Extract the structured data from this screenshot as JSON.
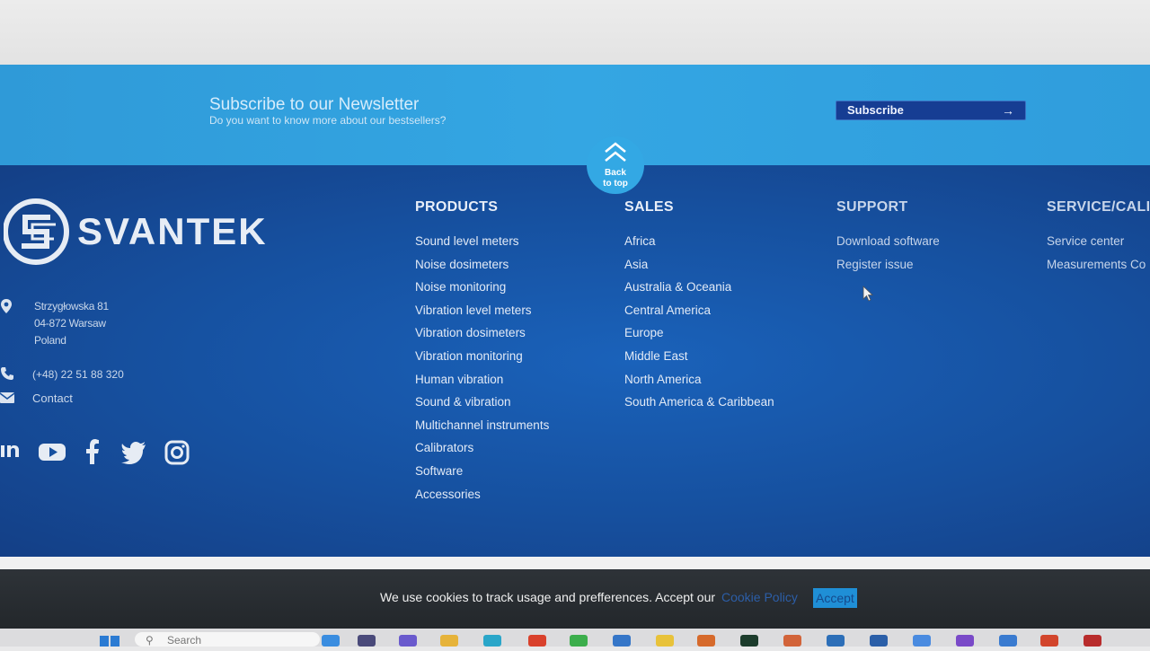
{
  "newsletter": {
    "title": "Subscribe to our Newsletter",
    "subtitle": "Do you want to know more about our bestsellers?",
    "button_label": "Subscribe"
  },
  "back_to_top": {
    "line1": "Back",
    "line2": "to top"
  },
  "brand": {
    "name": "SVANTEK"
  },
  "address": {
    "line1": "Strzygłowska 81",
    "line2": "04-872 Warsaw",
    "line3": "Poland"
  },
  "phone": "(+48) 22 51 88 320",
  "contact_label": "Contact",
  "columns": {
    "products": {
      "heading": "PRODUCTS",
      "items": [
        "Sound level meters",
        "Noise dosimeters",
        "Noise monitoring",
        "Vibration level meters",
        "Vibration dosimeters",
        "Vibration monitoring",
        "Human vibration",
        "Sound & vibration",
        "Multichannel instruments",
        "Calibrators",
        "Software",
        "Accessories"
      ]
    },
    "sales": {
      "heading": "SALES",
      "items": [
        "Africa",
        "Asia",
        "Australia & Oceania",
        "Central America",
        "Europe",
        "Middle East",
        "North America",
        "South America & Caribbean"
      ]
    },
    "support": {
      "heading": "SUPPORT",
      "items": [
        "Download software",
        "Register issue"
      ]
    },
    "service": {
      "heading": "SERVICE/CALI",
      "items": [
        "Service center",
        "Measurements Co"
      ]
    }
  },
  "cookie": {
    "text": "We use cookies to track usage and prefferences. Accept our",
    "link": "Cookie Policy",
    "accept": "Accept"
  },
  "taskbar": {
    "search_placeholder": "Search"
  },
  "colors": {
    "newsletter_bg": "#34a6e3",
    "footer_bg": "#16509f",
    "subscribe_btn": "#163d93",
    "cookie_bar": "#2a2f33",
    "accept_btn": "#1f8fd6"
  },
  "icons": [
    "chevron-up-icon",
    "arrow-right-icon",
    "location-pin-icon",
    "phone-icon",
    "mail-icon",
    "linkedin-icon",
    "youtube-icon",
    "facebook-icon",
    "twitter-icon",
    "instagram-icon",
    "mouse-cursor-icon",
    "windows-start-icon",
    "search-icon"
  ]
}
